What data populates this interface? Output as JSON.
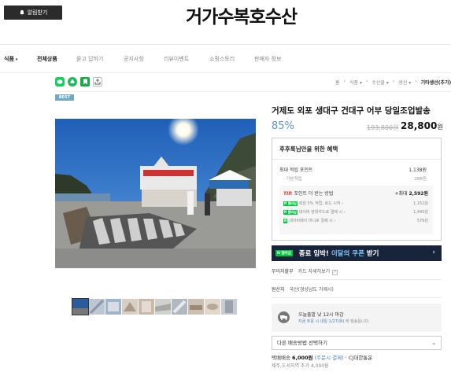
{
  "header": {
    "alarm_label": "알림받기",
    "logo": "거가수복호수산"
  },
  "nav": {
    "items": [
      {
        "label": "식품",
        "caret": "▾"
      },
      {
        "label": "전체상품"
      },
      {
        "label": "묻고 답하기"
      },
      {
        "label": "공지사항"
      },
      {
        "label": "리뷰이벤트"
      },
      {
        "label": "쇼핑스토리"
      },
      {
        "label": "판매자 정보"
      }
    ]
  },
  "share": {
    "icons": [
      "talk-icon",
      "band-icon",
      "bookmark-icon",
      "share-icon"
    ]
  },
  "breadcrumb": {
    "items": [
      "홈",
      "식품",
      "수산물",
      "생선"
    ],
    "last": "기타생선(추가)",
    "caret": "▾",
    "sep": "›"
  },
  "badge": {
    "best": "BEST"
  },
  "product": {
    "title": "거제도 외포 생대구 건대구 어부 당일조업발송",
    "discount": "85%",
    "old_price": "193,800원",
    "price": "28,800",
    "won": "원"
  },
  "benefit": {
    "title": "후후룩님만을 위한 혜택",
    "max_point_label": "최대 적립 포인트",
    "max_point_value": "1,138원",
    "basic_label": "· 기본적립",
    "basic_value": "288원",
    "tip_tag": "TIP.",
    "tip_text": "포인트 더 받는 방법",
    "tip_max_prefix": "+최대",
    "tip_max_value": "2,592원",
    "rows": [
      {
        "tag": "N 멤버십",
        "text": "회원 5% 적립, 로드 시작 ›",
        "value": "1,152원"
      },
      {
        "tag": "N 멤버십",
        "text": "네이버 현대카드로 결제 시 ›",
        "value": "1,440원"
      },
      {
        "tag": "",
        "text": "네이버페이 머니로 결제 시 ›",
        "value": "576원"
      }
    ]
  },
  "coupon": {
    "ntag": "N 멤버십",
    "text_a": "종료 임박! ",
    "text_b": "이달의 쿠폰",
    "text_c": " 받기",
    "arrow": "›"
  },
  "info": {
    "installment_key": "무이자할부",
    "installment_val": "카드 자세히보기",
    "origin_key": "원산지",
    "origin_val": "국산(경상남도 거제시)",
    "help": "?"
  },
  "shipping": {
    "line1": "오늘출발 낮 12시 마감",
    "line2_a": "지금 주문 시 내일 1/27(화)",
    "line2_b": " 에 발송됩니다.",
    "select_label": "다른 배송방법 선택하기",
    "chevron": "⌄",
    "fee_key": "택배배송",
    "fee_val": "6,000원",
    "fee_type": "(주문시 결제)",
    "fee_courier": "· CJ대한통운",
    "jeju": "제주,도서지역 추가 4,000원"
  },
  "colors": {
    "discount": "#5c96c2",
    "coupon_bg": "#18243a",
    "naver_green": "#00c73c",
    "tip_red": "#e0392c"
  }
}
